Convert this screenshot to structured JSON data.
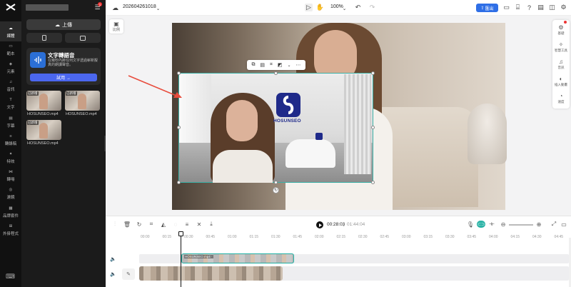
{
  "rail": {
    "items": [
      {
        "label": "媒體",
        "icon": "media-icon",
        "active": true
      },
      {
        "label": "範本",
        "icon": "template-icon"
      },
      {
        "label": "元素",
        "icon": "elements-icon"
      },
      {
        "label": "音訊",
        "icon": "audio-icon"
      },
      {
        "label": "文字",
        "icon": "text-icon"
      },
      {
        "label": "字幕",
        "icon": "captions-icon"
      },
      {
        "label": "轉錄稿",
        "icon": "transcript-icon"
      },
      {
        "label": "特效",
        "icon": "effects-icon"
      },
      {
        "label": "轉場",
        "icon": "transition-icon"
      },
      {
        "label": "濾鏡",
        "icon": "filter-icon"
      },
      {
        "label": "品牌套件",
        "icon": "brand-kit-icon"
      },
      {
        "label": "外掛程式",
        "icon": "plugins-icon"
      }
    ]
  },
  "panel": {
    "upload_label": "上傳",
    "promo": {
      "title": "文字轉語音",
      "description": "在幾秒內將任何文字透過嶄新擬真的朗讀聲音。",
      "button": "試用 →"
    },
    "media": [
      {
        "tag": "已新增",
        "name": "HOSUNSEO.mp4"
      },
      {
        "tag": "已新增",
        "name": "HOSUNSEO.mp4"
      },
      {
        "tag": "已新增",
        "name": "HOSUNSEO.mp4"
      }
    ]
  },
  "topbar": {
    "project_name": "202604261018",
    "zoom": "100%",
    "export_label": "匯出",
    "notification_count": "1"
  },
  "canvas": {
    "ratio_label": "比例",
    "overlay_logo_text": "HOSUNSEO"
  },
  "right_tools": [
    {
      "label": "基礎",
      "icon": "basic-icon"
    },
    {
      "label": "智慧工具",
      "icon": "smart-tools-icon"
    },
    {
      "label": "音訊",
      "icon": "audio-icon"
    },
    {
      "label": "插入動畫",
      "icon": "animation-icon"
    },
    {
      "label": "速度",
      "icon": "speed-icon"
    }
  ],
  "timeline": {
    "current_time": "00:28:03",
    "separator": "|",
    "total_time": "01:44:04",
    "ticks": [
      "00:00",
      "00:15",
      "00:30",
      "00:45",
      "01:00",
      "01:15",
      "01:30",
      "01:45",
      "02:00",
      "02:15",
      "02:30",
      "02:45",
      "03:00",
      "03:15",
      "03:30",
      "03:45",
      "04:00",
      "04:15",
      "04:30",
      "04:45",
      "05:00"
    ],
    "overlay_clip_label": "HOSUNSEO.mp4 ·"
  },
  "colors": {
    "accent": "#2f6fe6",
    "selection": "#3bb0a6",
    "arrow": "#e84c3d"
  }
}
